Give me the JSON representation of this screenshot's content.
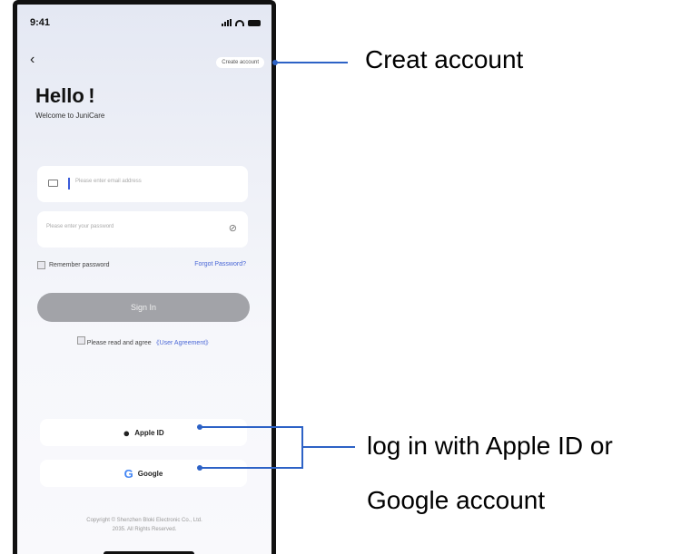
{
  "status_bar": {
    "time": "9:41"
  },
  "header": {
    "back_icon": "chevron-left-icon",
    "create_account_label": "Create account"
  },
  "greeting": {
    "title": "Hello !",
    "subtitle": "Welcome to JuniCare"
  },
  "form": {
    "email_placeholder": "Please enter email address",
    "password_placeholder": "Please enter your password",
    "remember_label": "Remember password",
    "forgot_label": "Forgot Password?",
    "sign_in_label": "Sign In",
    "agree_label": "Please read and agree",
    "agreement_link": "《User Agreement》"
  },
  "social": {
    "apple_label": "Apple ID",
    "google_label": "Google"
  },
  "footer": {
    "copyright_line1": "Copyright © Shenzhen Bloki Electronic Co., Ltd.",
    "copyright_line2": "2035. All Rights Reserved."
  },
  "annotations": {
    "create_account": "Creat account",
    "social_line1": "log in with Apple ID or",
    "social_line2": "Google account"
  },
  "colors": {
    "accent": "#2d62c6",
    "link": "#4a67d6",
    "button": "#a2a3a8"
  }
}
